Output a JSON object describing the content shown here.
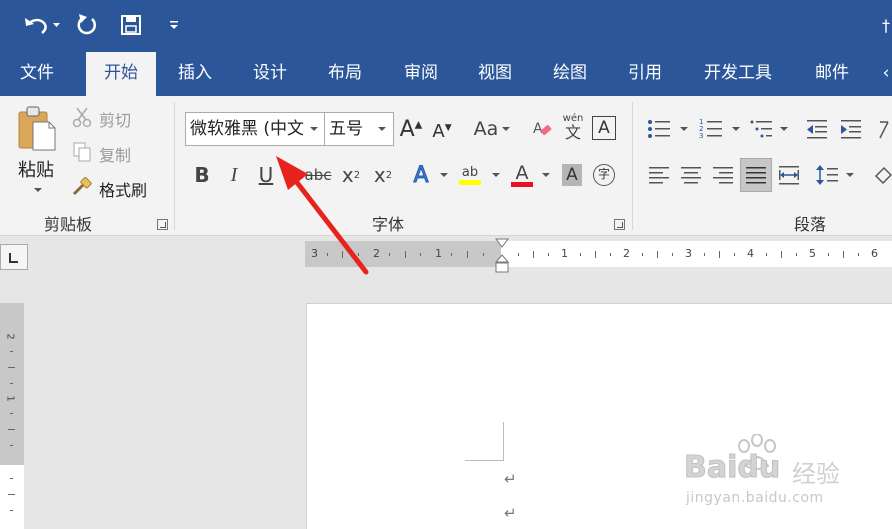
{
  "ribbon_tabs": [
    "文件",
    "开始",
    "插入",
    "设计",
    "布局",
    "审阅",
    "视图",
    "绘图",
    "引用",
    "开发工具",
    "邮件"
  ],
  "clipboard": {
    "paste": "粘贴",
    "cut": "剪切",
    "copy": "复制",
    "format_painter": "格式刷",
    "group_label": "剪贴板"
  },
  "font": {
    "font_name": "微软雅黑 (中文",
    "font_size": "五号",
    "change_case": "Aa",
    "phonetic_guide": "wén",
    "phonetic_char": "文",
    "bold": "B",
    "italic": "I",
    "underline": "U",
    "strikethrough": "abc",
    "subscript": "x",
    "subscript_mark": "2",
    "superscript": "x",
    "superscript_mark": "2",
    "highlight_text": "ab",
    "font_color_letter": "A",
    "shading_letter": "A",
    "enclose_char": "字",
    "group_label": "字体"
  },
  "paragraph": {
    "group_label": "段落"
  },
  "ruler": {
    "left_numbers": [
      "3",
      "2",
      "1"
    ],
    "right_numbers": [
      "1",
      "2",
      "3",
      "4",
      "5",
      "6"
    ],
    "vertical_numbers": [
      "2",
      "1"
    ]
  },
  "document": {
    "paragraph_mark": "↵"
  },
  "watermark": {
    "brand": "Baidu",
    "brand_cn": "经验",
    "url": "jingyan.baidu.com"
  },
  "colors": {
    "title_bar": "#2b579a",
    "ribbon": "#f3f3f3",
    "highlight_yellow": "#ffff00",
    "font_color_red": "#e81123",
    "arrow_red": "#e8231e"
  }
}
